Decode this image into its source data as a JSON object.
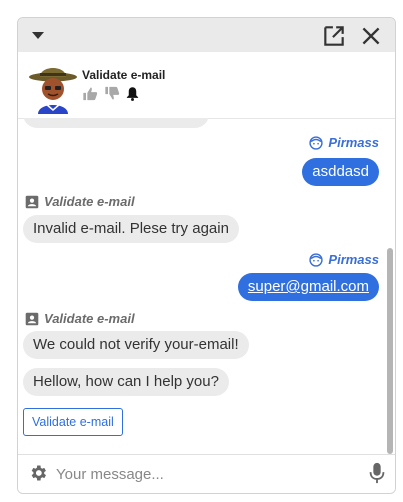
{
  "header": {
    "bot_name": "Validate e-mail"
  },
  "messages": [
    {
      "role": "bot",
      "sender": "Validate e-mail",
      "text": "Invalid e-mail. Plese try again"
    },
    {
      "role": "user",
      "sender": "Pirmass",
      "text": "asddasd"
    },
    {
      "role": "user",
      "sender": "Pirmass",
      "text": "super@gmail.com"
    },
    {
      "role": "bot",
      "sender": "Validate e-mail",
      "text": "We could not verify your-email!"
    },
    {
      "role": "bot",
      "sender": "",
      "text": "Hellow, how can I help you?"
    }
  ],
  "quick_reply": {
    "label": "Validate e-mail"
  },
  "composer": {
    "placeholder": "Your message..."
  },
  "icons": {
    "collapse": "chevron-down-icon",
    "popout": "open-in-new-icon",
    "close": "close-icon",
    "thumbs_up": "thumbs-up-icon",
    "thumbs_down": "thumbs-down-icon",
    "bell": "bell-icon",
    "bot_sender": "contact-card-icon",
    "user_sender": "user-face-icon",
    "settings": "gear-icon",
    "mic": "microphone-icon"
  },
  "colors": {
    "user_bubble": "#2f6fdf",
    "bot_bubble": "#ebebeb",
    "user_name": "#3a6fd8",
    "topbar": "#eaeaea"
  }
}
